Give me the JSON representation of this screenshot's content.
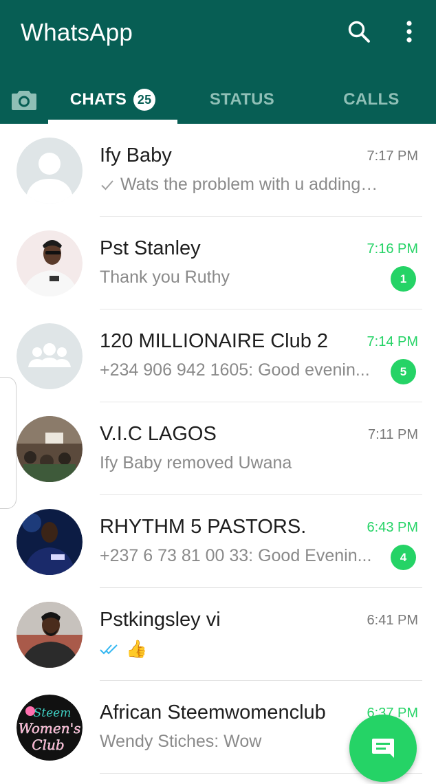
{
  "app": {
    "title": "WhatsApp"
  },
  "colors": {
    "header": "#075e54",
    "accent": "#25d366",
    "tab_inactive": "#8fbfb6"
  },
  "header": {
    "search_icon": "search-icon",
    "menu_icon": "more-vert-icon"
  },
  "tabs": {
    "camera_icon": "camera-icon",
    "chats": {
      "label": "CHATS",
      "badge": "25"
    },
    "status": {
      "label": "STATUS"
    },
    "calls": {
      "label": "CALLS"
    }
  },
  "chats": [
    {
      "name": "Ify Baby",
      "time": "7:17 PM",
      "preview": "Wats the problem with u adding a...",
      "unread": "",
      "status_icon": "single-check-icon",
      "avatar": "default-person-avatar"
    },
    {
      "name": "Pst Stanley",
      "time": "7:16 PM",
      "preview": "Thank you Ruthy",
      "unread": "1",
      "avatar": "photo-avatar"
    },
    {
      "name": "120 MILLIONAIRE Club 2",
      "time": "7:14 PM",
      "preview": "+234 906 942 1605: Good evenin...",
      "unread": "5",
      "avatar": "default-group-avatar"
    },
    {
      "name": "V.I.C LAGOS",
      "time": "7:11 PM",
      "preview": "Ify Baby removed Uwana",
      "unread": "",
      "avatar": "photo-avatar"
    },
    {
      "name": "RHYTHM 5 PASTORS.",
      "time": "6:43 PM",
      "preview": "+237 6 73 81 00 33: Good Evenin...",
      "unread": "4",
      "avatar": "photo-avatar"
    },
    {
      "name": "Pstkingsley vi",
      "time": "6:41 PM",
      "preview": "👍",
      "unread": "",
      "status_icon": "double-check-blue-icon",
      "avatar": "photo-avatar"
    },
    {
      "name": "African Steemwomenclub",
      "time": "6:37 PM",
      "preview": "Wendy Stiches: Wow",
      "unread": "",
      "avatar": "logo-avatar"
    }
  ],
  "fab": {
    "icon": "new-chat-icon"
  }
}
